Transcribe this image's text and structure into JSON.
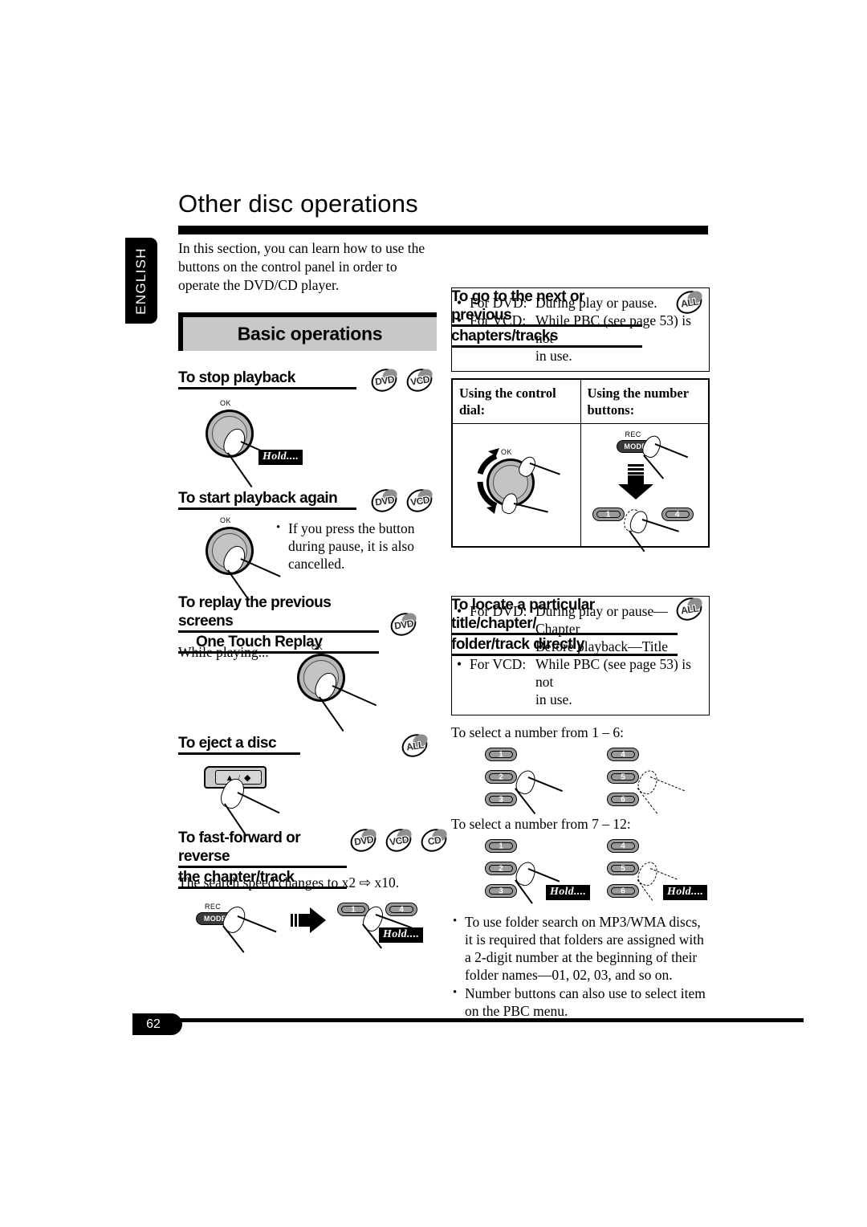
{
  "header": {
    "title": "Other disc operations",
    "language_tab": "ENGLISH"
  },
  "left_column": {
    "intro": "In this section, you can learn how to use the buttons on the control panel in order to operate the DVD/CD player.",
    "section_band": "Basic operations",
    "sections": [
      {
        "heading": "To stop playback",
        "badges": [
          "DVD",
          "VCD"
        ],
        "dial_label": "OK",
        "hold_label": "Hold...."
      },
      {
        "heading": "To start playback again",
        "badges": [
          "DVD",
          "VCD"
        ],
        "dial_label": "OK",
        "note": "If you press the button during pause, it is also cancelled."
      },
      {
        "heading_line1": "To replay the previous screens",
        "heading_line2": "One Touch Replay",
        "badges": [
          "DVD"
        ],
        "body": "While playing...",
        "dial_label": "OK"
      },
      {
        "heading": "To eject a disc",
        "badges": [
          "ALL"
        ],
        "eject_symbol": "▲ / ◆"
      },
      {
        "heading_line1": "To fast-forward or reverse",
        "heading_line2": "the chapter/track",
        "badges": [
          "DVD",
          "VCD",
          "CD"
        ],
        "body": "The search speed changes to x2 ⇨ x10.",
        "rec_label": "REC",
        "mode_label": "MODE",
        "buttons": [
          "1",
          "4"
        ],
        "hold_label": "Hold...."
      }
    ]
  },
  "right_column": {
    "sections": [
      {
        "heading_line1": "To go to the next or previous",
        "heading_line2": "chapters/tracks",
        "badges": [
          "ALL"
        ],
        "note_rows": [
          {
            "key": "For DVD:",
            "value": "During play or pause."
          },
          {
            "key": "For VCD:",
            "value": "While PBC (see page 53) is not"
          }
        ],
        "note_continuation": "in use.",
        "table": {
          "col1_header": "Using the control dial:",
          "col2_header": "Using the number buttons:",
          "dial_label": "OK",
          "rec_label": "REC",
          "mode_label": "MODE",
          "buttons": [
            "1",
            "4"
          ]
        }
      },
      {
        "heading_line1": "To locate a particular title/chapter/",
        "heading_line2": "folder/track directly",
        "badges": [
          "ALL"
        ],
        "note_rows": [
          {
            "key": "For DVD:",
            "value": "During play or pause—Chapter"
          },
          {
            "key": "",
            "value": "Before playback—Title"
          },
          {
            "key": "For VCD:",
            "value": "While PBC (see page 53) is not"
          }
        ],
        "note_continuation": "in use.",
        "select_1_6": "To select a number from 1 – 6:",
        "select_7_12": "To select a number from 7 – 12:",
        "keypad_left": [
          "1",
          "2",
          "3"
        ],
        "keypad_right": [
          "4",
          "5",
          "6"
        ],
        "hold_label": "Hold....",
        "bullets": [
          "To use folder search on MP3/WMA discs, it is required that folders are assigned with a 2-digit number at the beginning of their folder names—01, 02, 03, and so on.",
          "Number buttons can also use to select item on the PBC menu."
        ]
      }
    ]
  },
  "footer": {
    "page_number": "62"
  },
  "colors": {
    "ink": "#000000",
    "band_fill": "#c8c8c8",
    "button_fill": "#9a9a9a",
    "dial_fill": "#c4c4c4"
  }
}
